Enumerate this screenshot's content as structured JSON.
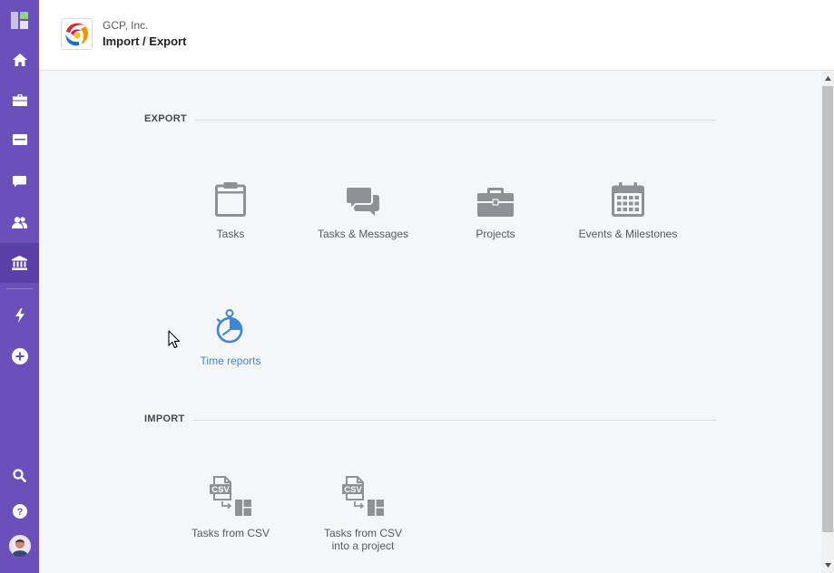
{
  "header": {
    "company": "GCP, Inc.",
    "title": "Import / Export"
  },
  "sidebar": {
    "items": [
      {
        "icon": "app-logo-icon"
      },
      {
        "icon": "home-icon"
      },
      {
        "icon": "briefcase-icon"
      },
      {
        "icon": "inbox-icon"
      },
      {
        "icon": "chat-icon"
      },
      {
        "icon": "people-icon"
      },
      {
        "icon": "bank-icon",
        "active": true
      },
      {
        "icon": "lightning-icon"
      },
      {
        "icon": "plus-circle-icon"
      },
      {
        "icon": "search-icon"
      },
      {
        "icon": "help-icon"
      },
      {
        "icon": "avatar"
      }
    ]
  },
  "export": {
    "label": "EXPORT",
    "items": [
      {
        "label": "Tasks",
        "icon": "clipboard-icon"
      },
      {
        "label": "Tasks & Messages",
        "icon": "messages-icon"
      },
      {
        "label": "Projects",
        "icon": "briefcase-icon"
      },
      {
        "label": "Events & Milestones",
        "icon": "calendar-icon"
      },
      {
        "label": "Time reports",
        "icon": "stopwatch-icon"
      }
    ]
  },
  "import": {
    "label": "IMPORT",
    "items": [
      {
        "label": "Tasks from CSV",
        "icon": "csv-import-icon"
      },
      {
        "label": "Tasks from CSV into a project",
        "icon": "csv-import-project-icon"
      }
    ]
  },
  "colors": {
    "sidebar": "#6b4fbb",
    "sidebar_active": "#5a40a6",
    "icon_gray": "#8e9196",
    "link_blue": "#3d86d9"
  }
}
